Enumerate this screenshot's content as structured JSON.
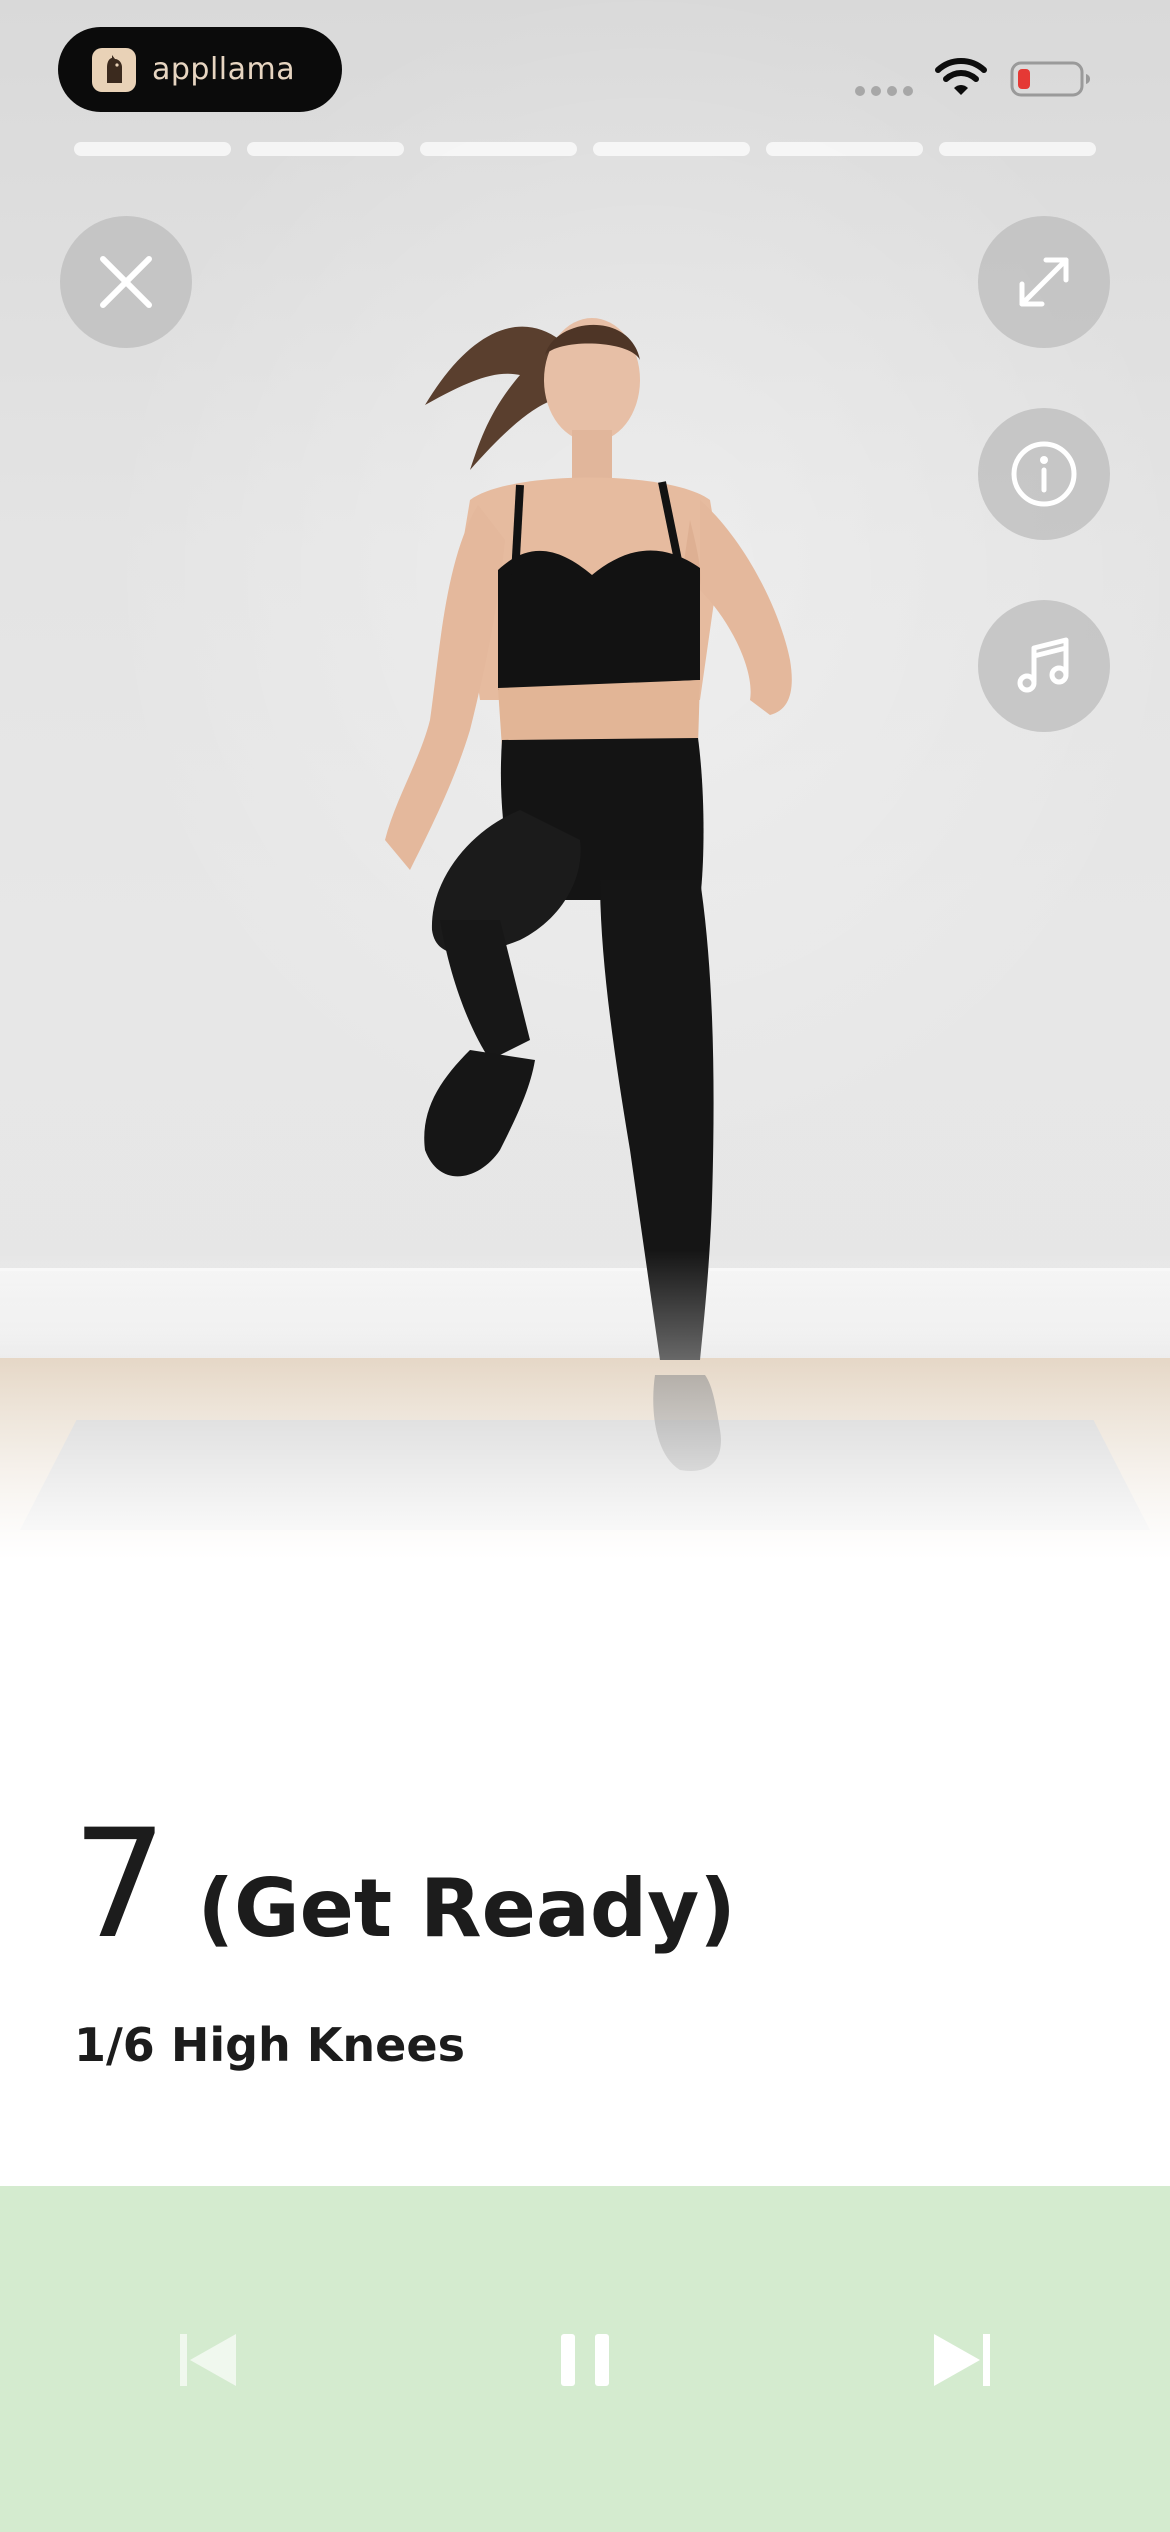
{
  "app": {
    "name": "appllama"
  },
  "status_bar": {
    "wifi_icon": "wifi-icon",
    "battery_icon": "battery-low-icon",
    "battery_color": "#e53935"
  },
  "progress": {
    "total_segments": 6
  },
  "overlay_buttons": {
    "close_icon": "close-icon",
    "expand_icon": "expand-icon",
    "info_icon": "info-icon",
    "music_icon": "music-icon"
  },
  "workout": {
    "countdown": "7",
    "phase": "(Get Ready)",
    "exercise": "1/6 High Knees"
  },
  "controls": {
    "background_color": "#d4ebcf",
    "previous_icon": "skip-previous-icon",
    "pause_icon": "pause-icon",
    "next_icon": "skip-next-icon"
  }
}
